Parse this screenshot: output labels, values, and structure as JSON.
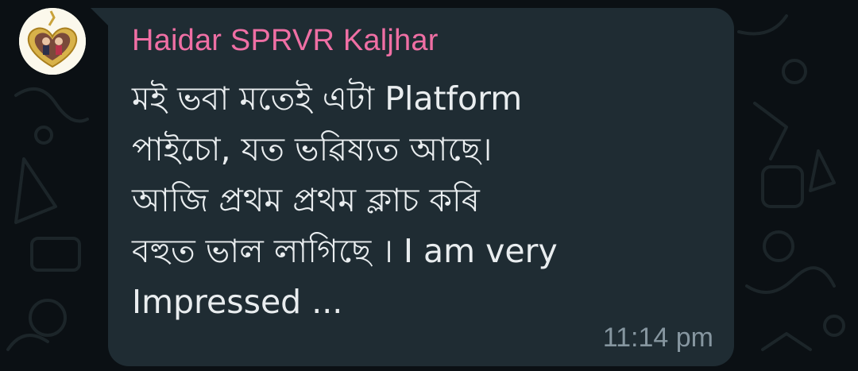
{
  "chat": {
    "sender_name": "Haidar SPRVR Kaljhar",
    "message_lines": [
      "মই ভবা মতেই এটা Platform",
      "পাইচো, যত ভৱিষ্যত আছে।",
      "আজি প্ৰথম প্ৰথম ক্লাচ কৰি",
      "বহুত ভাল লাগিছে । I am very",
      "Impressed  ..."
    ],
    "timestamp": "11:14 pm"
  },
  "colors": {
    "background": "#0b1014",
    "bubble": "#1f2c33",
    "sender_name": "#ef6fa4",
    "message_text": "#e9edef",
    "timestamp": "#8696a0"
  },
  "icons": {
    "avatar": "heart-locket-photo",
    "background": "chat-doodle-pattern"
  }
}
